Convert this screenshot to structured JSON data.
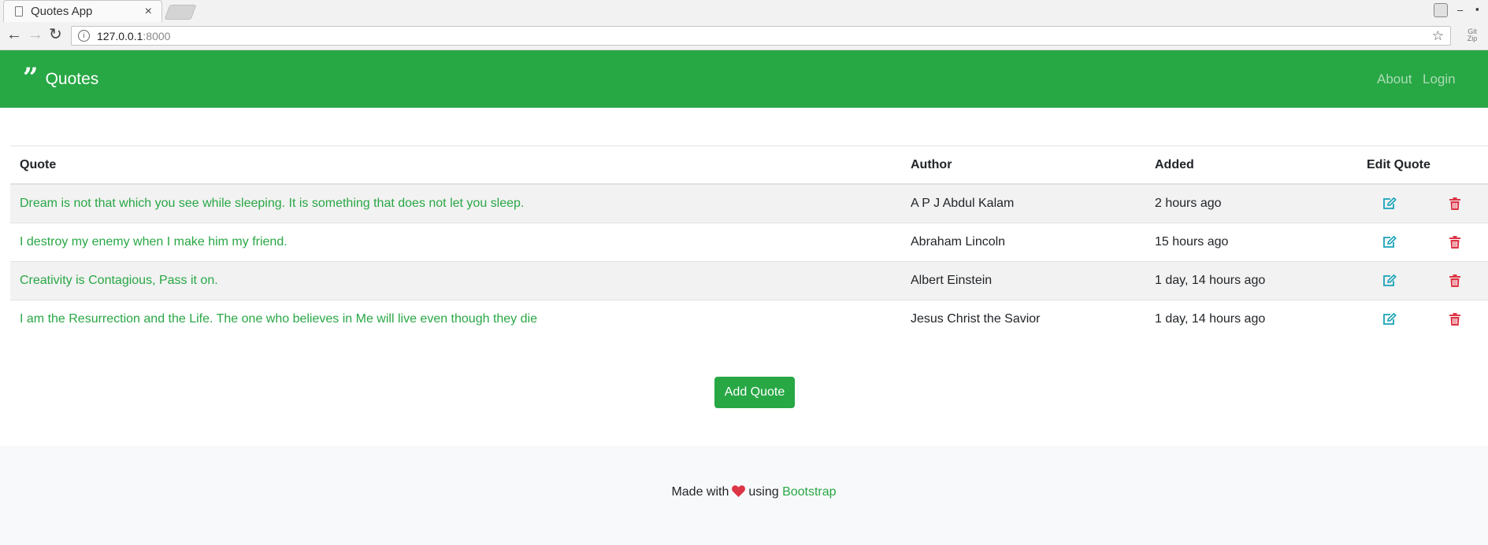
{
  "browser": {
    "tab_title": "Quotes App",
    "tab_close": "×",
    "url_host": "127.0.0.1",
    "url_port": ":8000",
    "extension_label": "Git Zip"
  },
  "navbar": {
    "brand": "Quotes",
    "links": [
      "About",
      "Login"
    ]
  },
  "table": {
    "headers": [
      "Quote",
      "Author",
      "Added",
      "Edit Quote"
    ],
    "rows": [
      {
        "quote": "Dream is not that which you see while sleeping. It is something that does not let you sleep.",
        "author": "A P J Abdul Kalam",
        "added": "2 hours ago"
      },
      {
        "quote": "I destroy my enemy when I make him my friend.",
        "author": "Abraham Lincoln",
        "added": "15 hours ago"
      },
      {
        "quote": "Creativity is Contagious, Pass it on.",
        "author": "Albert Einstein",
        "added": "1 day, 14 hours ago"
      },
      {
        "quote": "I am the Resurrection and the Life. The one who believes in Me will live even though they die",
        "author": "Jesus Christ the Savior",
        "added": "1 day, 14 hours ago"
      }
    ]
  },
  "add_button": "Add Quote",
  "footer": {
    "made_with": "Made with",
    "using": "using",
    "link": "Bootstrap"
  },
  "colors": {
    "brand_green": "#28a745",
    "edit_icon": "#17a2b8",
    "delete_icon": "#dc3545",
    "heart": "#dc3545"
  },
  "icons": {
    "brand": "quote-left-icon",
    "edit": "edit-icon",
    "delete": "trash-icon",
    "footer": "heart-icon"
  }
}
